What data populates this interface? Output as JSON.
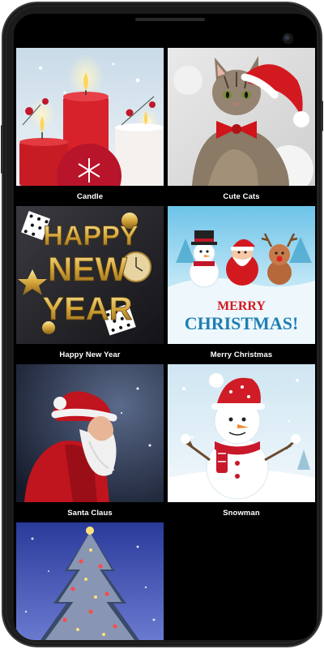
{
  "gallery": {
    "items": [
      {
        "label": "Candle",
        "icon": "candle-image"
      },
      {
        "label": "Cute Cats",
        "icon": "cat-image"
      },
      {
        "label": "Happy New Year",
        "icon": "new-year-image"
      },
      {
        "label": "Merry Christmas",
        "icon": "christmas-image"
      },
      {
        "label": "Santa Claus",
        "icon": "santa-image"
      },
      {
        "label": "Snowman",
        "icon": "snowman-image"
      },
      {
        "label": "",
        "icon": "christmas-tree-image"
      }
    ],
    "artwork_text": {
      "happy": "HAPPY",
      "new": "NEW",
      "year": "YEAR",
      "merry": "MERRY",
      "christmas": "CHRISTMAS!"
    }
  },
  "colors": {
    "background": "#000000",
    "label": "#ffffff",
    "frame": "#1b1b1b"
  }
}
